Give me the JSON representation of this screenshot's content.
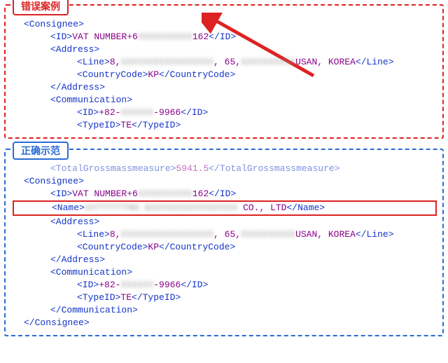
{
  "panels": {
    "wrong": {
      "title": "错误案例"
    },
    "correct": {
      "title": "正确示范"
    }
  },
  "tags": {
    "consignee_o": "<Consignee>",
    "consignee_c": "</Consignee>",
    "id_o": "<ID>",
    "id_c": "</ID>",
    "address_o": "<Address>",
    "address_c": "</Address>",
    "line_o": "<Line>",
    "line_c": "</Line>",
    "cc_o": "<CountryCode>",
    "cc_c": "</CountryCode>",
    "comm_o": "<Communication>",
    "comm_c": "</Communication>",
    "typeid_o": "<TypeID>",
    "typeid_c": "</TypeID>",
    "name_o": "<Name>",
    "name_c": "</Name>",
    "tgm_o": "<TotalGrossmassmeasure>",
    "tgm_c": "</TotalGrossmassmeasure>"
  },
  "wrong": {
    "id_prefix": "VAT NUMBER+6",
    "id_blur": "XXXXXXXXXX",
    "id_suffix": "162",
    "line_a": "8,",
    "line_blur1": "XXXXXXXXXXXXXXXXX",
    "line_b": ", 65,",
    "line_blur2": "XXXXXXXXXX",
    "line_c": "USAN, KOREA",
    "cc": "KP",
    "phone_a": "+82-",
    "phone_blur": "XXXXXX",
    "phone_b": "-9966",
    "typeid": "TE"
  },
  "correct": {
    "tgm_val": "5941.5",
    "id_prefix": "VAT NUMBER+6",
    "id_blur": "XXXXXXXXXX",
    "id_suffix": "162",
    "name_blur1": "XX",
    "name_mid": "TTTTTTNG &",
    "name_blur2": "XXXXXXXXXXXXXXXX",
    "name_suffix": " CO., LTD",
    "line_a": "8,",
    "line_blur1": "XXXXXXXXXXXXXXXXX",
    "line_b": ", 65,",
    "line_blur2": "XXXXXXXXXX",
    "line_c": "USAN, KOREA",
    "cc": "KP",
    "phone_a": "+82-",
    "phone_blur": "XXXXXX",
    "phone_b": "-9966",
    "typeid": "TE"
  }
}
